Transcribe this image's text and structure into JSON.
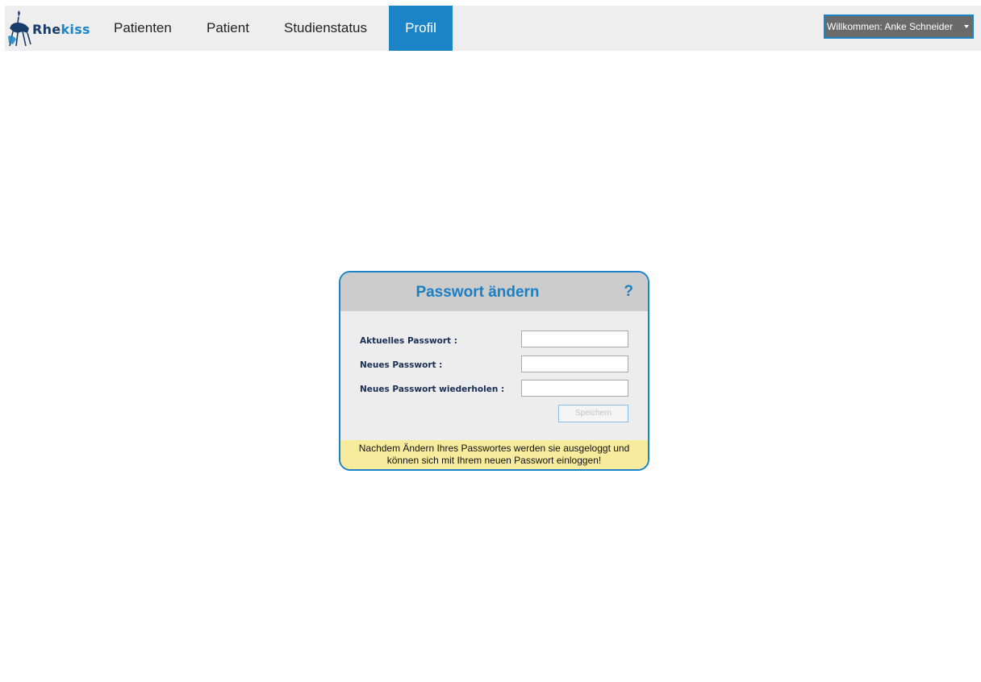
{
  "nav": {
    "logo": {
      "brand_part1": "Rhe",
      "brand_part2": "kiss",
      "icon": "deer-logo-icon"
    },
    "items": [
      {
        "label": "Patienten"
      },
      {
        "label": "Patient"
      },
      {
        "label": "Studienstatus"
      },
      {
        "label": "Profil",
        "active": true
      }
    ],
    "user_menu": {
      "label": "Willkommen: Anke Schneider",
      "icon": "caret-down-icon"
    }
  },
  "password_panel": {
    "title": "Passwort ändern",
    "help_label": "?",
    "fields": [
      {
        "label": "Aktuelles Passwort :",
        "value": ""
      },
      {
        "label": "Neues Passwort :",
        "value": ""
      },
      {
        "label": "Neues Passwort wiederholen :",
        "value": ""
      }
    ],
    "save_label": "Speichern",
    "notice_line1": "Nachdem Ändern Ihres Passwortes werden sie ausgeloggt und",
    "notice_line2": "können sich mit Ihrem neuen Passwort einloggen!"
  },
  "colors": {
    "accent": "#1b84c7",
    "navbar_bg": "#eeeeee",
    "panel_header_bg": "#cccccc",
    "notice_bg": "#f7ec9e",
    "label_color": "#1a2e55"
  }
}
